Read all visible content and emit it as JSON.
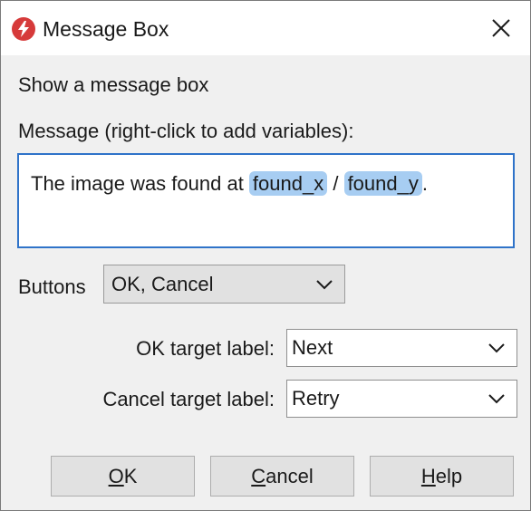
{
  "window": {
    "title": "Message Box",
    "icon": "red-bolt-icon",
    "close_icon": "close-icon"
  },
  "heading": "Show a message box",
  "message": {
    "label": "Message (right-click to add variables):",
    "text_before": "The image was found at ",
    "var1": "found_x",
    "separator": " / ",
    "var2": "found_y",
    "text_after": "."
  },
  "buttons_select": {
    "label": "Buttons",
    "value": "OK, Cancel"
  },
  "ok_target": {
    "label": "OK target label:",
    "value": "Next"
  },
  "cancel_target": {
    "label": "Cancel target label:",
    "value": "Retry"
  },
  "footer": {
    "ok_accel": "O",
    "ok_rest": "K",
    "cancel_accel": "C",
    "cancel_rest": "ancel",
    "help_accel": "H",
    "help_rest": "elp"
  },
  "colors": {
    "accent": "#2f73c9",
    "variable_highlight": "#a7cdf2",
    "icon_red": "#d63a3a"
  }
}
